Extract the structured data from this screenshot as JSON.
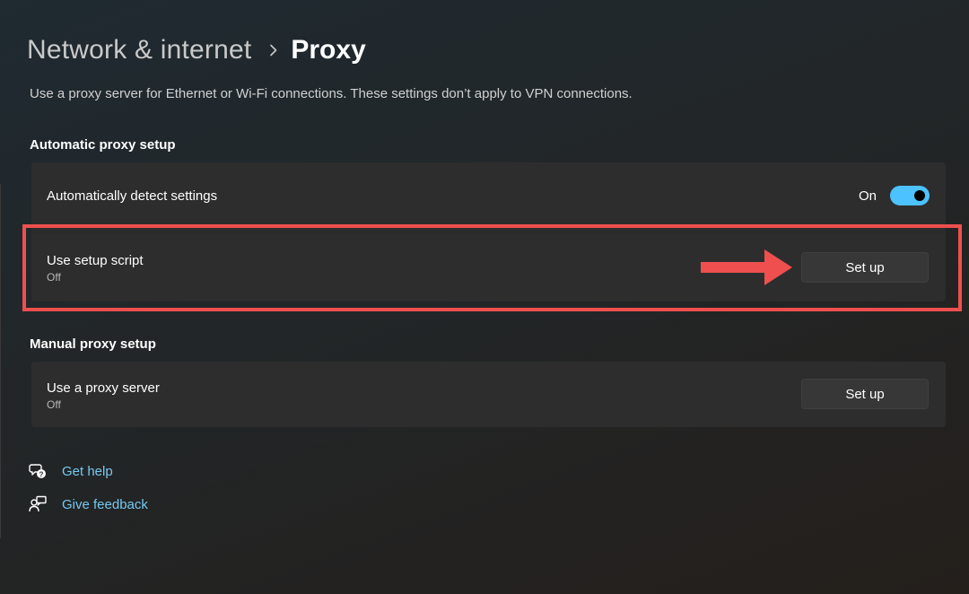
{
  "breadcrumb": {
    "parent": "Network & internet",
    "current": "Proxy"
  },
  "description": "Use a proxy server for Ethernet or Wi-Fi connections. These settings don’t apply to VPN connections.",
  "automatic_section": {
    "title": "Automatic proxy setup",
    "auto_detect": {
      "label": "Automatically detect settings",
      "state_text": "On",
      "toggle_on": true
    },
    "setup_script": {
      "label": "Use setup script",
      "status": "Off",
      "button_label": "Set up"
    }
  },
  "manual_section": {
    "title": "Manual proxy setup",
    "proxy_server": {
      "label": "Use a proxy server",
      "status": "Off",
      "button_label": "Set up"
    }
  },
  "links": {
    "help": "Get help",
    "feedback": "Give feedback"
  },
  "colors": {
    "accent": "#4cc2ff",
    "highlight": "#ef4f4f",
    "link": "#76c8f0"
  },
  "icons": {
    "breadcrumb_separator": "chevron-right-icon",
    "help": "help-chat-icon",
    "feedback": "feedback-icon",
    "annotation": "arrow-right-icon"
  }
}
